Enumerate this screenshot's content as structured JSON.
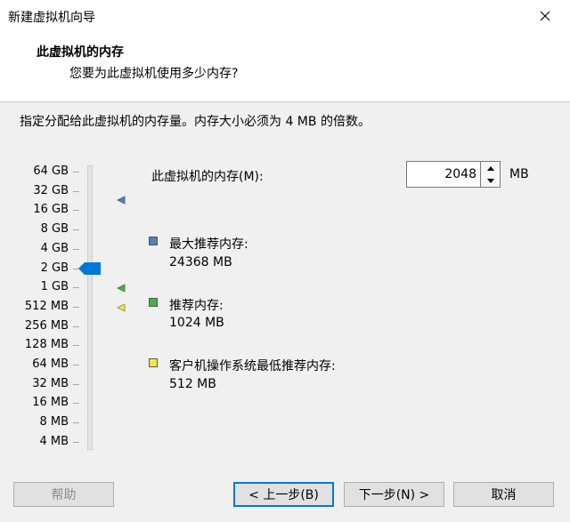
{
  "window": {
    "title": "新建虚拟机向导"
  },
  "header": {
    "title": "此虚拟机的内存",
    "subtitle": "您要为此虚拟机使用多少内存?"
  },
  "instruction": "指定分配给此虚拟机的内存量。内存大小必须为 4 MB 的倍数。",
  "slider": {
    "ticks": [
      "64 GB",
      "32 GB",
      "16 GB",
      "8 GB",
      "4 GB",
      "2 GB",
      "1 GB",
      "512 MB",
      "256 MB",
      "128 MB",
      "64 MB",
      "32 MB",
      "16 MB",
      "8 MB",
      "4 MB"
    ],
    "selected": "2 GB"
  },
  "memory": {
    "label": "此虚拟机的内存(M):",
    "value": "2048",
    "unit": "MB"
  },
  "recommendations": {
    "max": {
      "label": "最大推荐内存:",
      "value": "24368 MB",
      "color": "#4f81bd"
    },
    "recommended": {
      "label": "推荐内存:",
      "value": "1024 MB",
      "color": "#44b244"
    },
    "min": {
      "label": "客户机操作系统最低推荐内存:",
      "value": "512 MB",
      "color": "#f2e84a"
    }
  },
  "buttons": {
    "help": "帮助",
    "back": "< 上一步(B)",
    "next": "下一步(N) >",
    "cancel": "取消"
  },
  "colors": {
    "thumb": "#0078d7",
    "default_border": "#0078d7"
  }
}
